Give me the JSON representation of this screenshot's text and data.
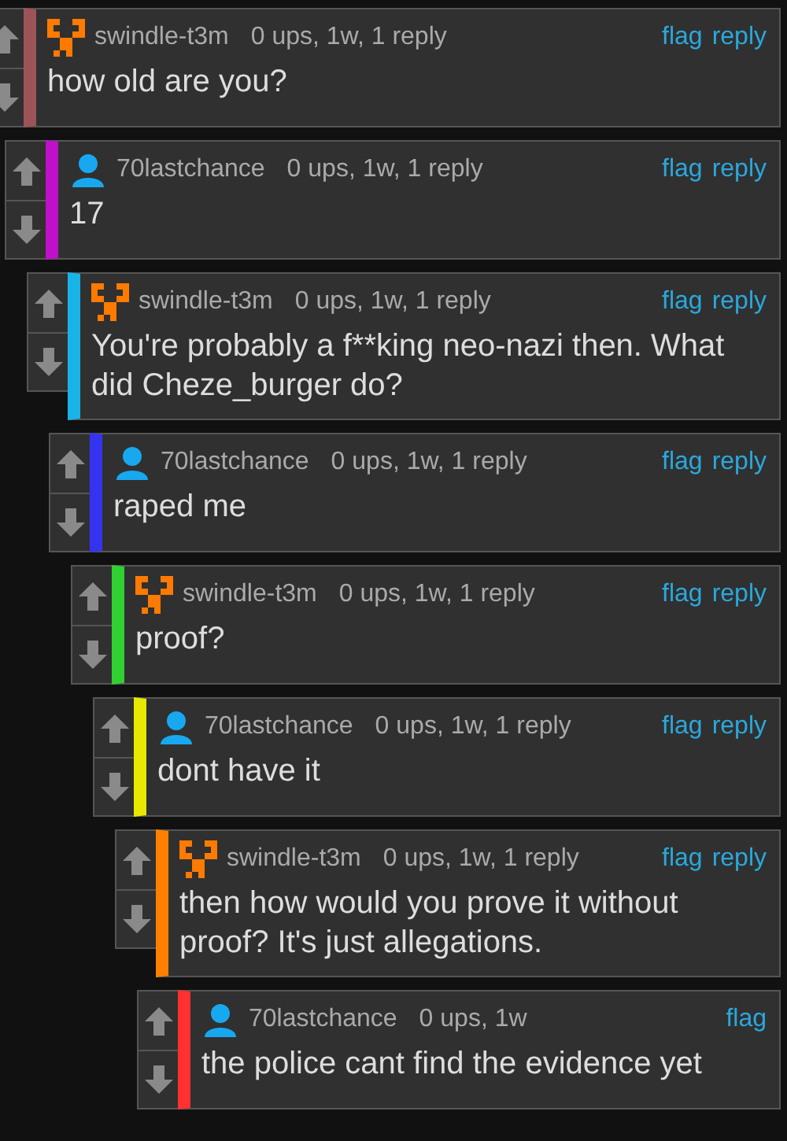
{
  "comments": [
    {
      "kind": "pixel",
      "color": "#9c5458",
      "user": "swindle-t3m",
      "meta": "0 ups, 1w, 1 reply",
      "actions": [
        "flag",
        "reply"
      ],
      "text": "how old are you?",
      "children": [
        {
          "kind": "person",
          "color": "#c010c8",
          "user": "70lastchance",
          "meta": "0 ups, 1w, 1 reply",
          "actions": [
            "flag",
            "reply"
          ],
          "text": "17",
          "children": [
            {
              "kind": "pixel",
              "color": "#18b4e8",
              "user": "swindle-t3m",
              "meta": "0 ups, 1w, 1 reply",
              "actions": [
                "flag",
                "reply"
              ],
              "text": "You're probably a f**king neo-nazi then. What did Cheze_burger do?",
              "children": [
                {
                  "kind": "person",
                  "color": "#3434f0",
                  "user": "70lastchance",
                  "meta": "0 ups, 1w, 1 reply",
                  "actions": [
                    "flag",
                    "reply"
                  ],
                  "text": "raped me",
                  "children": [
                    {
                      "kind": "pixel",
                      "color": "#30d030",
                      "user": "swindle-t3m",
                      "meta": "0 ups, 1w, 1 reply",
                      "actions": [
                        "flag",
                        "reply"
                      ],
                      "text": "proof?",
                      "children": [
                        {
                          "kind": "person",
                          "color": "#e8e800",
                          "user": "70lastchance",
                          "meta": "0 ups, 1w, 1 reply",
                          "actions": [
                            "flag",
                            "reply"
                          ],
                          "text": "dont have it",
                          "children": [
                            {
                              "kind": "pixel",
                              "color": "#ff8000",
                              "user": "swindle-t3m",
                              "meta": "0 ups, 1w, 1 reply",
                              "actions": [
                                "flag",
                                "reply"
                              ],
                              "text": "then how would you prove it without proof? It's just allegations.",
                              "children": [
                                {
                                  "kind": "person",
                                  "color": "#ff3030",
                                  "user": "70lastchance",
                                  "meta": "0 ups, 1w",
                                  "actions": [
                                    "flag"
                                  ],
                                  "text": "the police cant find the evidence yet"
                                }
                              ]
                            }
                          ]
                        }
                      ]
                    }
                  ]
                }
              ]
            }
          ]
        }
      ]
    }
  ]
}
